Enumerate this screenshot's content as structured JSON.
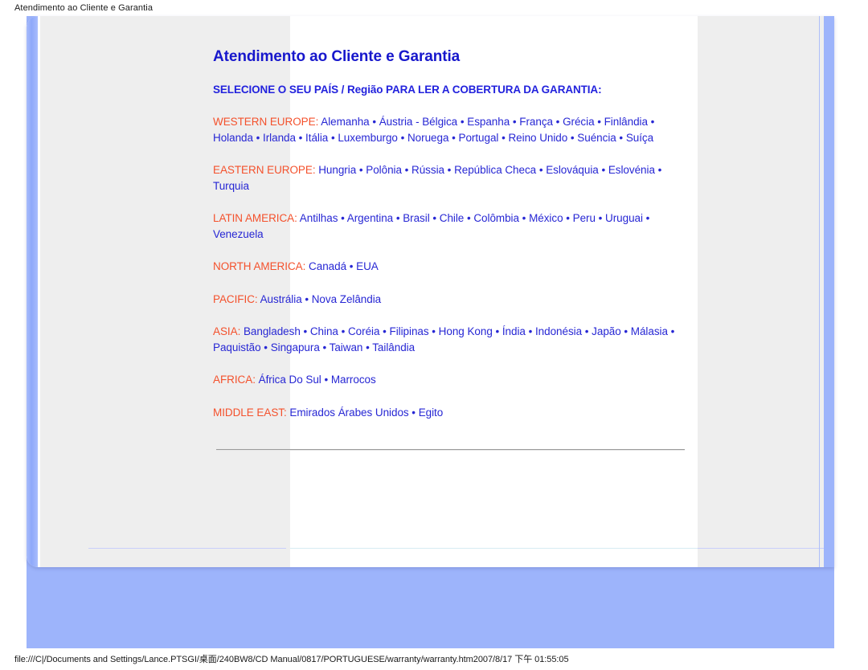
{
  "print_header": "Atendimento ao Cliente e Garantia",
  "print_footer": "file:///C|/Documents and Settings/Lance.PTSGI/桌面/240BW8/CD Manual/0817/PORTUGUESE/warranty/warranty.htm2007/8/17 下午 01:55:05",
  "colors": {
    "page_background": "#9db4fb",
    "card_background": "#ffffff",
    "column_grey": "#eeeeee",
    "title_blue": "#1717cc",
    "link_blue": "#2727d4",
    "region_label_orange": "#f4512c",
    "rule_grey": "#9b9b9b"
  },
  "article": {
    "title": "Atendimento ao Cliente e Garantia",
    "subtitle": "SELECIONE O SEU PAÍS / Região PARA LER A COBERTURA DA GARANTIA:",
    "regions": [
      {
        "label": "WESTERN EUROPE:",
        "countries": [
          "Alemanha",
          "Áustria - Bélgica",
          "Espanha",
          "França",
          "Grécia",
          "Finlândia",
          "Holanda",
          "Irlanda",
          "Itália",
          "Luxemburgo",
          "Noruega",
          "Portugal",
          "Reino Unido",
          "Suéncia",
          "Suíça"
        ]
      },
      {
        "label": "EASTERN EUROPE:",
        "countries": [
          "Hungria",
          "Polônia",
          "Rússia",
          "República Checa",
          "Eslováquia",
          "Eslovénia",
          "Turquia"
        ]
      },
      {
        "label": "LATIN AMERICA:",
        "countries": [
          "Antilhas",
          "Argentina",
          "Brasil",
          "Chile",
          "Colômbia",
          "México",
          "Peru",
          "Uruguai",
          "Venezuela"
        ]
      },
      {
        "label": "NORTH AMERICA:",
        "countries": [
          "Canadá",
          "EUA"
        ]
      },
      {
        "label": "PACIFIC:",
        "countries": [
          "Austrália",
          "Nova Zelândia"
        ]
      },
      {
        "label": "ASIA:",
        "countries": [
          "Bangladesh",
          "China",
          "Coréia",
          "Filipinas",
          "Hong Kong",
          "Índia",
          "Indonésia",
          "Japão",
          "Málasia",
          "Paquistão",
          "Singapura",
          "Taiwan",
          "Tailândia"
        ]
      },
      {
        "label": "AFRICA:",
        "countries": [
          "África Do Sul",
          "Marrocos"
        ]
      },
      {
        "label": "MIDDLE EAST:",
        "countries": [
          "Emirados Árabes Unidos",
          "Egito"
        ]
      }
    ],
    "separator": "•"
  }
}
